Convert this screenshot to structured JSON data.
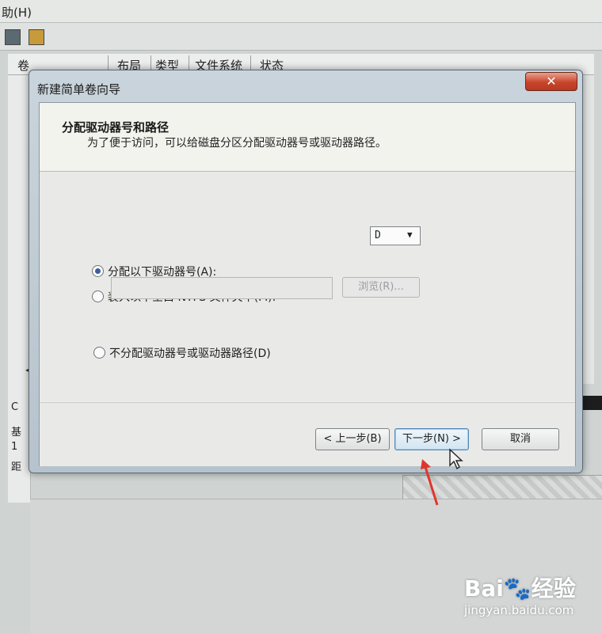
{
  "background": {
    "menu_fragment": "助(H)",
    "columns": [
      "卷",
      "布局",
      "类型",
      "文件系统",
      "状态"
    ],
    "left_chars": [
      "C",
      "基",
      "1",
      "距"
    ]
  },
  "dialog": {
    "title": "新建简单卷向导",
    "close_symbol": "✕",
    "header_title": "分配驱动器号和路径",
    "header_desc": "为了便于访问，可以给磁盘分区分配驱动器号或驱动器路径。",
    "options": [
      {
        "label": "分配以下驱动器号(A):",
        "checked": true
      },
      {
        "label": "装入以下空白 NTFS 文件夹中(M):",
        "checked": false
      },
      {
        "label": "不分配驱动器号或驱动器路径(D)",
        "checked": false
      }
    ],
    "drive_letter": "D",
    "path_value": "",
    "browse_label": "浏览(R)...",
    "buttons": {
      "prev": "< 上一步(B)",
      "next": "下一步(N) >",
      "cancel": "取消"
    }
  },
  "watermark": {
    "logo": "Bai🐾经验",
    "url": "jingyan.baidu.com"
  },
  "colors": {
    "accent": "#3a5f9a",
    "close_button": "#c8452b",
    "arrow": "#e0362b"
  }
}
